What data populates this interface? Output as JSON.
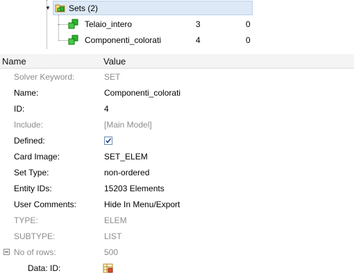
{
  "tree": {
    "root": {
      "label": "Sets (2)",
      "icon": "folder-sets-icon"
    },
    "children": [
      {
        "label": "Telaio_intero",
        "col1": "3",
        "col2": "0",
        "icon": "set-icon"
      },
      {
        "label": "Componenti_colorati",
        "col1": "4",
        "col2": "0",
        "icon": "set-icon"
      }
    ]
  },
  "table": {
    "headers": {
      "name": "Name",
      "value": "Value"
    },
    "rows": [
      {
        "name": "Solver Keyword:",
        "value": "SET",
        "muted": true
      },
      {
        "name": "Name:",
        "value": "Componenti_colorati"
      },
      {
        "name": "ID:",
        "value": "4"
      },
      {
        "name": "Include:",
        "value": "[Main Model]",
        "muted": true
      },
      {
        "name": "Defined:",
        "value": "",
        "checked": true
      },
      {
        "name": "Card Image:",
        "value": "SET_ELEM"
      },
      {
        "name": "Set Type:",
        "value": "non-ordered"
      },
      {
        "name": "Entity IDs:",
        "value": "15203 Elements"
      },
      {
        "name": "User Comments:",
        "value": "Hide In Menu/Export"
      },
      {
        "name": "TYPE:",
        "value": "ELEM",
        "muted": true
      },
      {
        "name": "SUBTYPE:",
        "value": "LIST",
        "muted": true
      },
      {
        "name": "No of rows:",
        "value": "500",
        "muted": true
      },
      {
        "name": "Data: ID:",
        "value": "",
        "icon": "table-data-icon"
      }
    ]
  },
  "colors": {
    "selection_bg": "#dde9f6",
    "set_icon_green": "#2db52d",
    "muted_text": "#8c8c8c"
  }
}
